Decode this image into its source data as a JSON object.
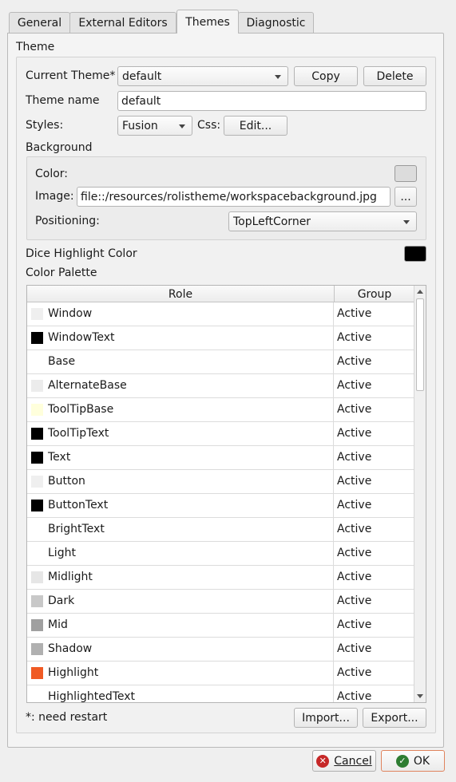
{
  "tabs": [
    {
      "label": "General"
    },
    {
      "label": "External Editors"
    },
    {
      "label": "Themes"
    },
    {
      "label": "Diagnostic"
    }
  ],
  "theme": {
    "group_label": "Theme",
    "current_theme_label": "Current Theme*",
    "current_theme_value": "default",
    "copy_label": "Copy",
    "delete_label": "Delete",
    "theme_name_label": "Theme name",
    "theme_name_value": "default",
    "styles_label": "Styles:",
    "styles_value": "Fusion",
    "css_label": "Css:",
    "css_edit_label": "Edit...",
    "background": {
      "group_label": "Background",
      "color_label": "Color:",
      "color_value": "#dcdcdc",
      "image_label": "Image:",
      "image_value": "file::/resources/rolistheme/workspacebackground.jpg",
      "browse_label": "...",
      "positioning_label": "Positioning:",
      "positioning_value": "TopLeftCorner"
    },
    "dice_highlight_label": "Dice Highlight Color",
    "dice_highlight_color": "#000000",
    "palette_label": "Color Palette",
    "palette": {
      "columns": [
        "Role",
        "Group"
      ],
      "rows": [
        {
          "role": "Window",
          "group": "Active",
          "color": "#efefef"
        },
        {
          "role": "WindowText",
          "group": "Active",
          "color": "#000000"
        },
        {
          "role": "Base",
          "group": "Active",
          "color": "#ffffff"
        },
        {
          "role": "AlternateBase",
          "group": "Active",
          "color": "#ececec"
        },
        {
          "role": "ToolTipBase",
          "group": "Active",
          "color": "#ffffdc"
        },
        {
          "role": "ToolTipText",
          "group": "Active",
          "color": "#000000"
        },
        {
          "role": "Text",
          "group": "Active",
          "color": "#000000"
        },
        {
          "role": "Button",
          "group": "Active",
          "color": "#efefef"
        },
        {
          "role": "ButtonText",
          "group": "Active",
          "color": "#000000"
        },
        {
          "role": "BrightText",
          "group": "Active",
          "color": "#ffffff"
        },
        {
          "role": "Light",
          "group": "Active",
          "color": "#ffffff"
        },
        {
          "role": "Midlight",
          "group": "Active",
          "color": "#e6e6e6"
        },
        {
          "role": "Dark",
          "group": "Active",
          "color": "#c8c8c8"
        },
        {
          "role": "Mid",
          "group": "Active",
          "color": "#a0a0a0"
        },
        {
          "role": "Shadow",
          "group": "Active",
          "color": "#b0b0b0"
        },
        {
          "role": "Highlight",
          "group": "Active",
          "color": "#f05a24"
        },
        {
          "role": "HighlightedText",
          "group": "Active",
          "color": "#ffffff"
        }
      ]
    },
    "restart_note": "*: need restart",
    "import_label": "Import...",
    "export_label": "Export..."
  },
  "dialog": {
    "cancel_label": "Cancel",
    "ok_label": "OK",
    "cancel_icon_color": "#c62828",
    "ok_icon_color": "#2e7d32",
    "accent": "#e0845e"
  }
}
